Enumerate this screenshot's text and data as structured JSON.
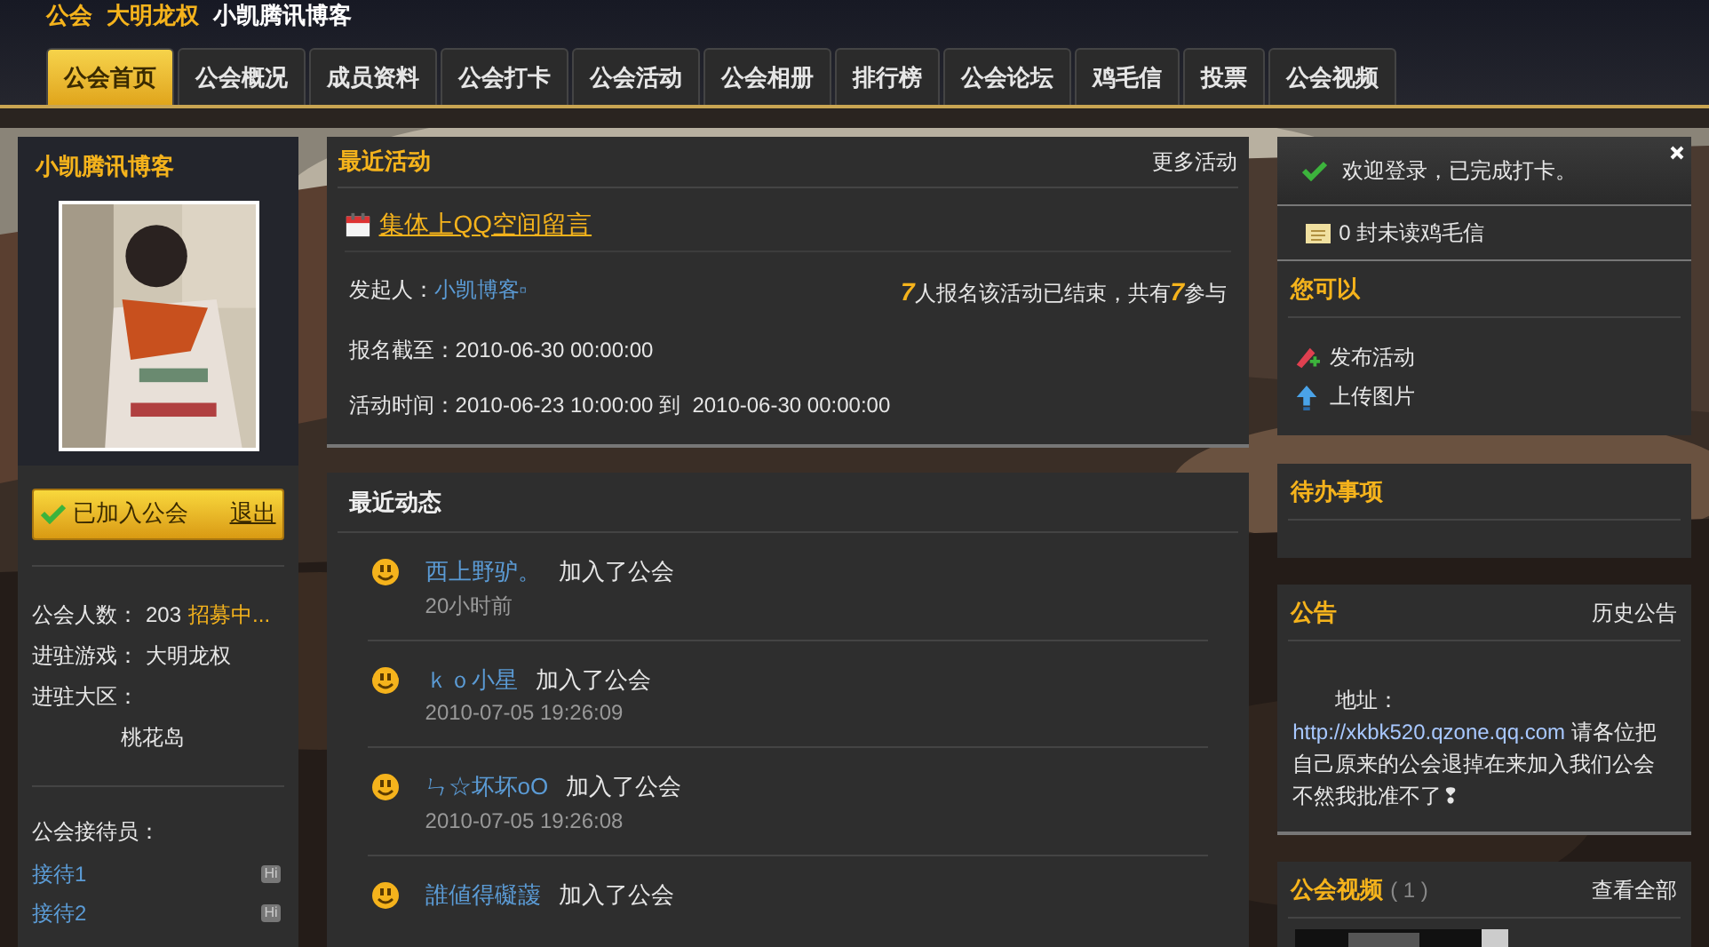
{
  "breadcrumb": [
    "公会",
    "大明龙权",
    "小凯腾讯博客"
  ],
  "tabs": [
    {
      "label": "公会首页",
      "selected": true
    },
    {
      "label": "公会概况",
      "selected": false
    },
    {
      "label": "成员资料",
      "selected": false
    },
    {
      "label": "公会打卡",
      "selected": false
    },
    {
      "label": "公会活动",
      "selected": false
    },
    {
      "label": "公会相册",
      "selected": false
    },
    {
      "label": "排行榜",
      "selected": false
    },
    {
      "label": "公会论坛",
      "selected": false
    },
    {
      "label": "鸡毛信",
      "selected": false
    },
    {
      "label": "投票",
      "selected": false
    },
    {
      "label": "公会视频",
      "selected": false
    }
  ],
  "profile": {
    "name": "小凯腾讯博客",
    "joined": true,
    "status": "已加入公会",
    "leave": "退出",
    "stats": [
      {
        "label": "公会人数：",
        "value": "203",
        "extra": "招募中..."
      },
      {
        "label": "进驻游戏：",
        "value": "大明龙权"
      },
      {
        "label": "进驻大区：",
        "value": "桃花岛"
      }
    ],
    "receptionists_title": "公会接待员：",
    "receptionists": [
      {
        "name": "接待1",
        "badge": "Hi"
      },
      {
        "name": "接待2",
        "badge": "Hi"
      }
    ]
  },
  "recent_activity": {
    "title": "最近活动",
    "more": "更多活动",
    "event": {
      "title": "集体上QQ空间留言",
      "organizer_label": "发起人：",
      "organizer": "小凯博客▫",
      "summary": "**7**人报名该活动已结束，共有**7**参与",
      "deadline": "报名截至：2010-06-30 00:00:00",
      "time": "活动时间：2010-06-23 10:00:00 到  2010-06-30 00:00:00"
    }
  },
  "recent_feed": {
    "title": "最近动态",
    "items": [
      {
        "user": "西上野驴。",
        "action": "加入了公会",
        "time": "20小时前"
      },
      {
        "user": "ｋｏ小星",
        "action": "加入了公会",
        "time": "2010-07-05 19:26:09"
      },
      {
        "user": "ㄣ☆坏坏oO",
        "action": "加入了公会",
        "time": "2010-07-05 19:26:08"
      },
      {
        "user": "誰値得礙蘐",
        "action": "加入了公会"
      }
    ]
  },
  "notice": {
    "text": "欢迎登录，已完成打卡。",
    "mail": "0 封未读鸡毛信"
  },
  "can_do": {
    "title": "您可以",
    "actions": [
      {
        "label": "发布活动",
        "kind": "publish"
      },
      {
        "label": "上传图片",
        "kind": "upload"
      }
    ]
  },
  "todo": {
    "title": "待办事项"
  },
  "announcement": {
    "title": "公告",
    "more": "历史公告",
    "lead": "地址：",
    "link": "http://xkbk520.qzone.qq.com",
    "text": " 请各位把自己原来的公会退掉在来加入我们公会不然我批准不了❢"
  },
  "videos": {
    "title": "公会视频",
    "count": "( 1 )",
    "more": "查看全部"
  }
}
